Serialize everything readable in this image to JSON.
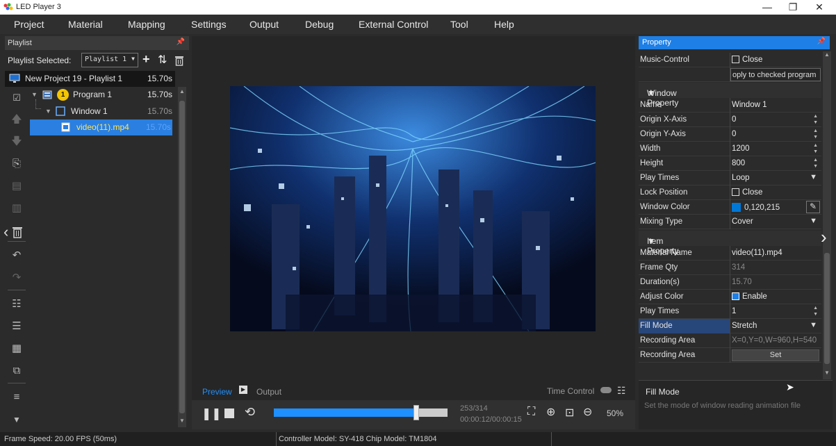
{
  "window": {
    "title": "LED Player 3",
    "min": "—",
    "max": "❐",
    "close": "✕"
  },
  "menu": [
    "Project",
    "Material",
    "Mapping",
    "Settings",
    "Output",
    "Debug",
    "External Control",
    "Tool",
    "Help"
  ],
  "playlist": {
    "header": "Playlist",
    "selected_label": "Playlist Selected:",
    "selected_value": "Playlist 1",
    "tree": [
      {
        "label": "New Project 19 - Playlist 1",
        "duration": "15.70s"
      },
      {
        "label": "Program 1",
        "badge": "1",
        "duration": "15.70s"
      },
      {
        "label": "Window 1",
        "duration": "15.70s"
      },
      {
        "label": "video(11).mp4",
        "duration": "15.70s"
      }
    ]
  },
  "preview": {
    "tabs": {
      "preview": "Preview",
      "output": "Output"
    },
    "time_control": "Time Control",
    "frames": "253/314",
    "time": "00:00:12/00:00:15",
    "zoom": "50%",
    "progress": 0.82
  },
  "property": {
    "header": "Property",
    "music_control": {
      "key": "Music-Control",
      "value": "Close"
    },
    "apply_text": "oply to checked program",
    "window_section": "Window Property",
    "window": [
      {
        "key": "Name",
        "value": "Window 1"
      },
      {
        "key": "Origin X-Axis",
        "value": "0"
      },
      {
        "key": "Origin Y-Axis",
        "value": "0"
      },
      {
        "key": "Width",
        "value": "1200"
      },
      {
        "key": "Height",
        "value": "800"
      },
      {
        "key": "Play Times",
        "value": "Loop"
      },
      {
        "key": "Lock Position",
        "value": "Close"
      },
      {
        "key": "Window Color",
        "value": "0,120,215"
      },
      {
        "key": "Mixing Type",
        "value": "Cover"
      }
    ],
    "item_section": "Item Property",
    "item": [
      {
        "key": "Material Name",
        "value": "video(11).mp4"
      },
      {
        "key": "Frame Qty",
        "value": "314"
      },
      {
        "key": "Duration(s)",
        "value": "15.70"
      },
      {
        "key": "Adjust Color",
        "value": "Enable"
      },
      {
        "key": "Play Times",
        "value": "1"
      },
      {
        "key": "Fill Mode",
        "value": "Stretch"
      },
      {
        "key": "Recording Area",
        "value": "X=0,Y=0,W=960,H=540"
      },
      {
        "key": "Recording Area",
        "value": "Set"
      }
    ],
    "help_title": "Fill Mode",
    "help_text": "Set the mode of window reading animation file"
  },
  "status": {
    "frame_speed": "Frame Speed:  20.00 FPS (50ms)",
    "controller": "Controller Model: SY-418  Chip Model: TM1804"
  },
  "colors": {
    "accent": "#1e90ff",
    "window_color": "#0078d7"
  }
}
